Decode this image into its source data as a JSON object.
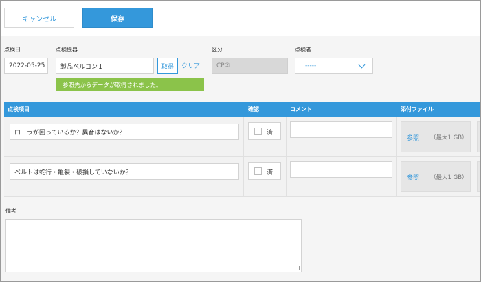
{
  "toolbar": {
    "cancel_label": "キャンセル",
    "save_label": "保存"
  },
  "form": {
    "inspection_date": {
      "label": "点検日",
      "value": "2022-05-25"
    },
    "equipment": {
      "label": "点検機器",
      "value": "製品ベルコン１",
      "get_label": "取得",
      "clear_label": "クリア"
    },
    "category": {
      "label": "区分",
      "value": "CP②"
    },
    "inspector": {
      "label": "点検者",
      "value": "-----"
    },
    "notice": "参照先からデータが取得されました。"
  },
  "table": {
    "headers": {
      "item": "点検項目",
      "confirm": "確認",
      "comment": "コメント",
      "attachment": "添付ファイル"
    },
    "rows": [
      {
        "item": "ローラが回っているか？異音はないか？",
        "confirm_label": "済",
        "comment": "",
        "file_ref": "参照",
        "file_max": "（最大1 GB）"
      },
      {
        "item": "ベルトは蛇行・亀裂・破損していないか？",
        "confirm_label": "済",
        "comment": "",
        "file_ref": "参照",
        "file_max": "（最大1 GB）"
      }
    ]
  },
  "remarks": {
    "label": "備考",
    "value": ""
  },
  "colors": {
    "accent": "#3498db",
    "notice_bg": "#8bc34a",
    "header_bg": "#3498db"
  }
}
